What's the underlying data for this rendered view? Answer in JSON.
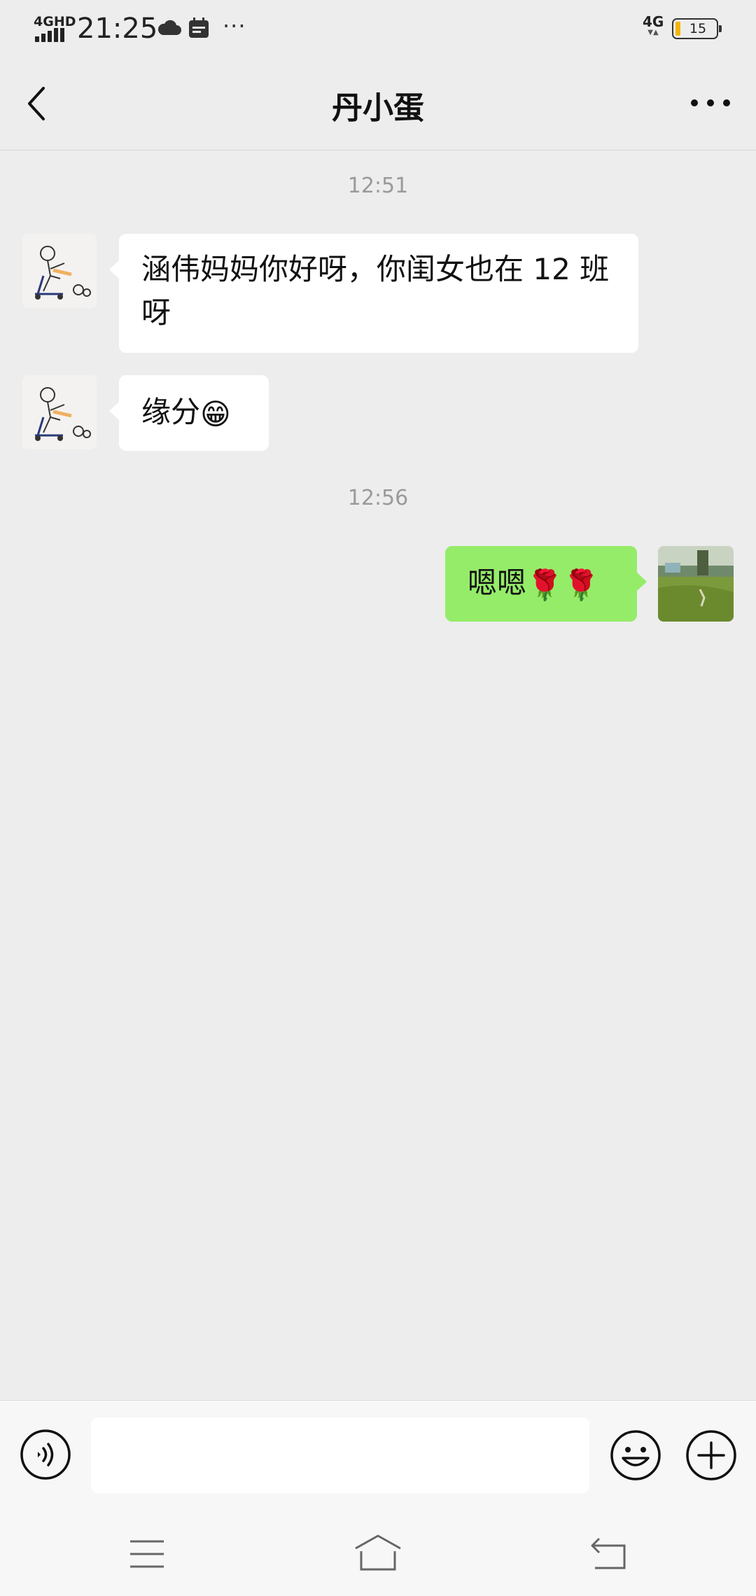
{
  "status_bar": {
    "network_label": "4GHD",
    "time": "21:25",
    "more": "···",
    "cellular_label": "4G",
    "battery_level": "15",
    "battery_fraction": 0.15
  },
  "header": {
    "title": "丹小蛋",
    "back_icon": "chevron-left-icon",
    "more_icon": "more-dots-icon"
  },
  "messages": {
    "time_1": "12:51",
    "msg_1": "涵伟妈妈你好呀，你闺女也在 12 班呀",
    "msg_2_text": "缘分",
    "msg_2_emoji": "😁",
    "time_2": "12:56",
    "msg_3_text": "嗯嗯",
    "msg_3_emoji": "🌹🌹"
  },
  "input_bar": {
    "value": "",
    "voice_icon": "voice-icon",
    "emoji_icon": "emoji-icon",
    "plus_icon": "plus-icon"
  },
  "nav_bar": {
    "menu_icon": "menu-icon",
    "home_icon": "home-icon",
    "back_icon": "back-icon"
  },
  "colors": {
    "background": "#ededed",
    "bubble_incoming": "#ffffff",
    "bubble_outgoing": "#95ec69",
    "time_text": "#9a9a9a"
  }
}
